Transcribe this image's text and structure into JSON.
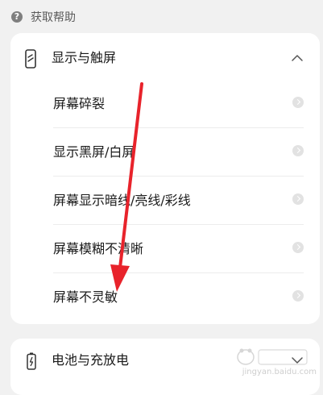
{
  "section": {
    "title": "获取帮助",
    "icon": "question-circle-icon"
  },
  "categories": [
    {
      "title": "显示与触屏",
      "icon": "phone-screen-icon",
      "expanded": true,
      "items": [
        {
          "label": "屏幕碎裂"
        },
        {
          "label": "显示黑屏/白屏"
        },
        {
          "label": "屏幕显示暗线/亮线/彩线"
        },
        {
          "label": "屏幕模糊不清晰"
        },
        {
          "label": "屏幕不灵敏"
        }
      ]
    },
    {
      "title": "电池与充放电",
      "icon": "battery-charging-icon",
      "expanded": false
    }
  ],
  "watermark": {
    "text": "jingyan.baidu.com",
    "logo": "baidu-jingyan-logo"
  },
  "colors": {
    "background": "#f1f1f1",
    "card": "#ffffff",
    "annotation": "#e8232b"
  }
}
